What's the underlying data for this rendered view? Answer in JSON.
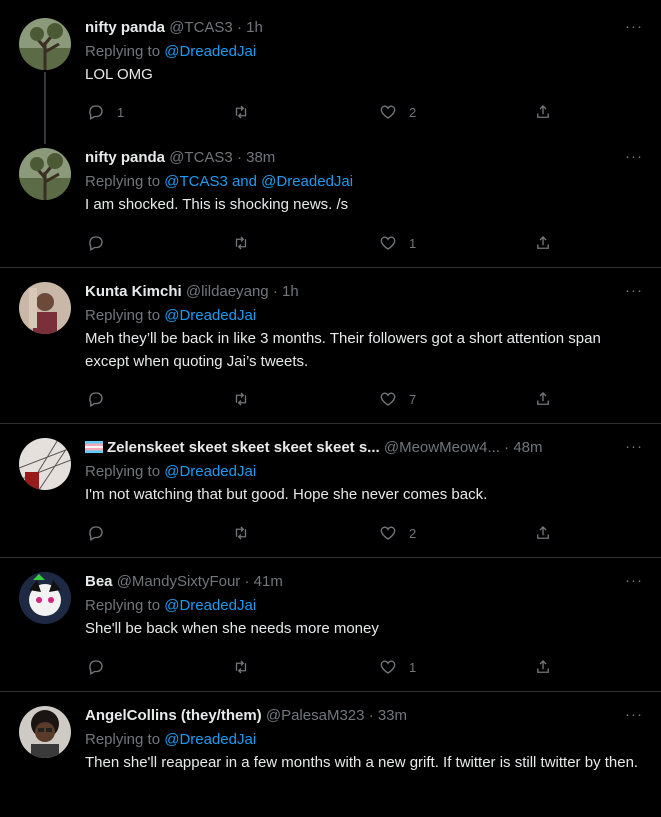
{
  "tweets": [
    {
      "name": "nifty panda",
      "handle": "@TCAS3",
      "sep": "·",
      "time": "1h",
      "reply_prefix": "Replying to ",
      "reply_to": "@DreadedJai",
      "text": "LOL OMG",
      "replies": "1",
      "retweets": "",
      "likes": "2",
      "avatar_color": "#6b7a5a"
    },
    {
      "name": "nifty panda",
      "handle": "@TCAS3",
      "sep": "·",
      "time": "38m",
      "reply_prefix": "Replying to ",
      "reply_to": "@TCAS3 and @DreadedJai",
      "text": "I am shocked. This is shocking news. /s",
      "replies": "",
      "retweets": "",
      "likes": "1",
      "avatar_color": "#6b7a5a"
    },
    {
      "name": "Kunta Kimchi",
      "handle": "@lildaeyang",
      "sep": "·",
      "time": "1h",
      "reply_prefix": "Replying to ",
      "reply_to": "@DreadedJai",
      "text": "Meh they’ll be back in like 3 months. Their followers got a short attention span except when quoting Jai’s tweets.",
      "replies": "",
      "retweets": "",
      "likes": "7",
      "avatar_color": "#8a5a4a"
    },
    {
      "name": "Zelenskeet skeet skeet skeet skeet s...",
      "handle": "@MeowMeow4...",
      "sep": "·",
      "time": "48m",
      "reply_prefix": "Replying to ",
      "reply_to": "@DreadedJai",
      "text": "I'm not watching that but good. Hope she never comes back.",
      "replies": "",
      "retweets": "",
      "likes": "2",
      "avatar_color": "#cfc8c4"
    },
    {
      "name": "Bea",
      "handle": "@MandySixtyFour",
      "sep": "·",
      "time": "41m",
      "reply_prefix": "Replying to ",
      "reply_to": "@DreadedJai",
      "text": "She'll be back when she needs more money",
      "replies": "",
      "retweets": "",
      "likes": "1",
      "avatar_color": "#2a2f4a"
    },
    {
      "name": "AngelCollins (they/them)",
      "handle": "@PalesaM323",
      "sep": "·",
      "time": "33m",
      "reply_prefix": "Replying to ",
      "reply_to": "@DreadedJai",
      "text": "Then she'll reappear in a few months with a new grift. If twitter is still twitter by then.",
      "replies": "",
      "retweets": "",
      "likes": "",
      "avatar_color": "#3a2a22"
    }
  ],
  "more_label": "···",
  "colors": {
    "accent": "#1d9bf0",
    "muted": "#71767b",
    "text": "#e7e9ea",
    "border": "#2f3336",
    "background": "#000000"
  }
}
